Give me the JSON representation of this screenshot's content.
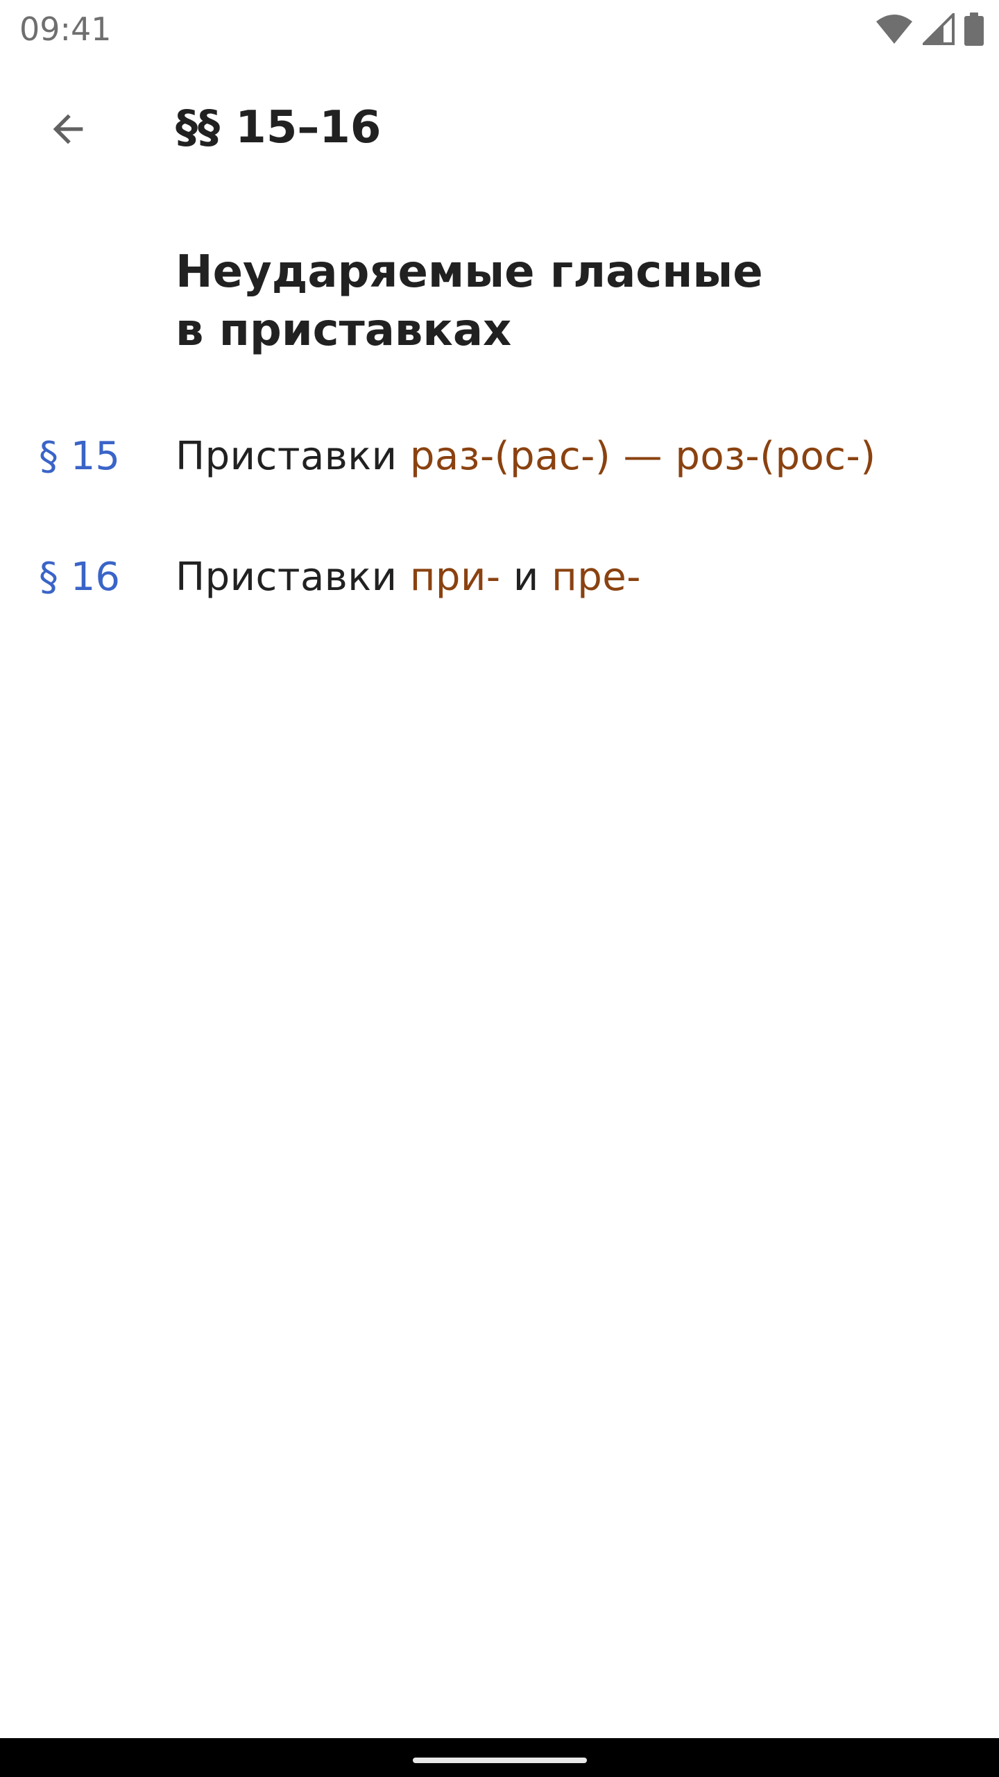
{
  "status_bar": {
    "time": "09:41",
    "icons": [
      "wifi-icon",
      "cellular-signal-icon",
      "battery-icon"
    ]
  },
  "app_bar": {
    "back_icon": "arrow-back-icon",
    "title": "§§ 15–16"
  },
  "section": {
    "heading_line1": "Неударяемые гласные",
    "heading_line2": "в приставках"
  },
  "rules": [
    {
      "number": "§ 15",
      "prefix_text": "Приставки ",
      "part1": "раз-(рас-) — роз-(рос-)",
      "connector": "",
      "part2": ""
    },
    {
      "number": "§ 16",
      "prefix_text": "Приставки ",
      "part1": "при-",
      "connector": " и ",
      "part2": "пре-"
    }
  ],
  "colors": {
    "rule_number": "#3a64c8",
    "accent_text": "#8a4210",
    "primary_text": "#212121"
  }
}
